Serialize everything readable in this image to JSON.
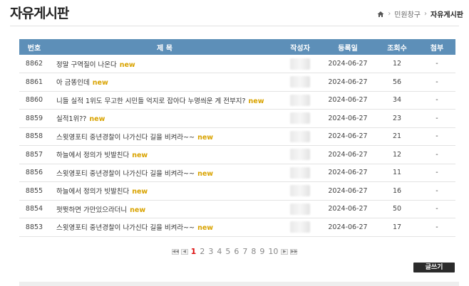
{
  "page": {
    "title": "자유게시판"
  },
  "breadcrumb": {
    "items": [
      "민원창구",
      "자유게시판"
    ]
  },
  "table": {
    "headers": [
      "번호",
      "제 목",
      "작성자",
      "등록일",
      "조회수",
      "첨부"
    ],
    "new_label": "new",
    "rows": [
      {
        "no": "8862",
        "title": "정말 구역질이 나온다",
        "date": "2024-06-27",
        "views": "12",
        "attach": "-"
      },
      {
        "no": "8861",
        "title": "아 금똥인데",
        "date": "2024-06-27",
        "views": "56",
        "attach": "-"
      },
      {
        "no": "8860",
        "title": "니들 실적 1위도 무고한 시민들 억지로 잡아다 누명씌운 게 전부지?",
        "date": "2024-06-27",
        "views": "34",
        "attach": "-"
      },
      {
        "no": "8859",
        "title": "실적1위??",
        "date": "2024-06-27",
        "views": "23",
        "attach": "-"
      },
      {
        "no": "8858",
        "title": "스윗영포티 중년경찰이 나가신다 길을 비켜라~~",
        "date": "2024-06-27",
        "views": "21",
        "attach": "-"
      },
      {
        "no": "8857",
        "title": "하늘에서 정의가 빗발친다",
        "date": "2024-06-27",
        "views": "12",
        "attach": "-"
      },
      {
        "no": "8856",
        "title": "스윗영포티 중년경찰이 나가신다 길을 비켜라~~",
        "date": "2024-06-27",
        "views": "11",
        "attach": "-"
      },
      {
        "no": "8855",
        "title": "하늘에서 정의가 빗발친다",
        "date": "2024-06-27",
        "views": "16",
        "attach": "-"
      },
      {
        "no": "8854",
        "title": "펏뜃하면 가만있으라더니",
        "date": "2024-06-27",
        "views": "50",
        "attach": "-"
      },
      {
        "no": "8853",
        "title": "스윗영포티 중년경찰이 나가신다 길을 비켜라~~",
        "date": "2024-06-27",
        "views": "17",
        "attach": "-"
      }
    ]
  },
  "pagination": {
    "pages": [
      "1",
      "2",
      "3",
      "4",
      "5",
      "6",
      "7",
      "8",
      "9",
      "10"
    ],
    "current": "1",
    "first_icon": "double-left-arrow-icon",
    "prev_icon": "left-arrow-icon",
    "next_icon": "right-arrow-icon",
    "last_icon": "double-right-arrow-icon"
  },
  "actions": {
    "write_label": "글쓰기"
  },
  "colors": {
    "header_bg": "#5d8fb8",
    "new_badge": "#d9a300",
    "active_page": "#dd1111",
    "write_button": "#2b2b2b"
  },
  "icons": {
    "home": "home-icon"
  }
}
